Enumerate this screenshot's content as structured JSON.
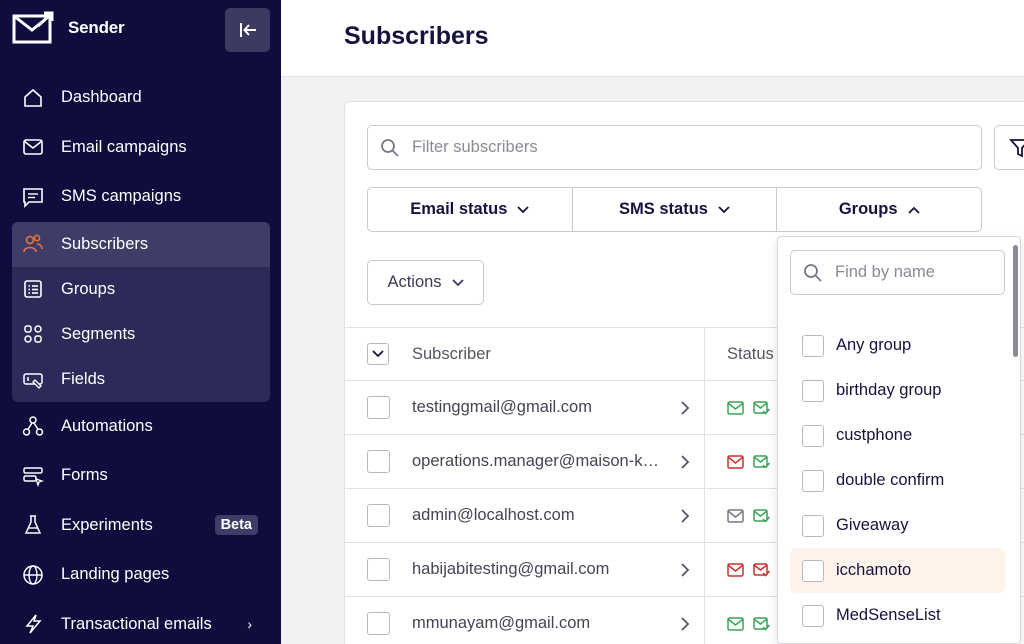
{
  "app": {
    "name": "Sender"
  },
  "sidebar": {
    "items": [
      {
        "label": "Dashboard",
        "icon": "home-icon"
      },
      {
        "label": "Email campaigns",
        "icon": "mail-icon"
      },
      {
        "label": "SMS campaigns",
        "icon": "chat-icon"
      }
    ],
    "group": [
      {
        "label": "Subscribers",
        "icon": "users-icon"
      },
      {
        "label": "Groups",
        "icon": "list-icon"
      },
      {
        "label": "Segments",
        "icon": "grid-icon"
      },
      {
        "label": "Fields",
        "icon": "fields-icon"
      }
    ],
    "items2": [
      {
        "label": "Automations",
        "icon": "automation-icon"
      },
      {
        "label": "Forms",
        "icon": "forms-icon"
      },
      {
        "label": "Experiments",
        "icon": "flask-icon",
        "badge": "Beta"
      },
      {
        "label": "Landing pages",
        "icon": "globe-icon"
      },
      {
        "label": "Transactional emails",
        "icon": "bolt-icon",
        "chevron": "›"
      }
    ]
  },
  "header": {
    "title": "Subscribers"
  },
  "filters": {
    "search_placeholder": "Filter subscribers",
    "email_status": "Email status",
    "sms_status": "SMS status",
    "groups": "Groups",
    "actions": "Actions"
  },
  "table": {
    "col_subscriber": "Subscriber",
    "col_status": "Status",
    "rows": [
      {
        "email": "testinggmail@gmail.com",
        "email_status": "green",
        "sms_status": "green"
      },
      {
        "email": "operations.manager@maison-k…",
        "email_status": "red",
        "sms_status": "green"
      },
      {
        "email": "admin@localhost.com",
        "email_status": "gray",
        "sms_status": "green"
      },
      {
        "email": "habijabitesting@gmail.com",
        "email_status": "red",
        "sms_status": "red"
      },
      {
        "email": "mmunayam@gmail.com",
        "email_status": "green",
        "sms_status": "green"
      }
    ]
  },
  "dropdown": {
    "search_placeholder": "Find by name",
    "options": [
      "Any group",
      "birthday group",
      "custphone",
      "double confirm",
      "Giveaway",
      "icchamoto",
      "MedSenseList"
    ]
  },
  "colors": {
    "sidebar_bg": "#0f0d3d",
    "accent_orange": "#e8743b",
    "status_green": "#3aa35a",
    "status_red": "#c9302c",
    "status_gray": "#777788"
  }
}
